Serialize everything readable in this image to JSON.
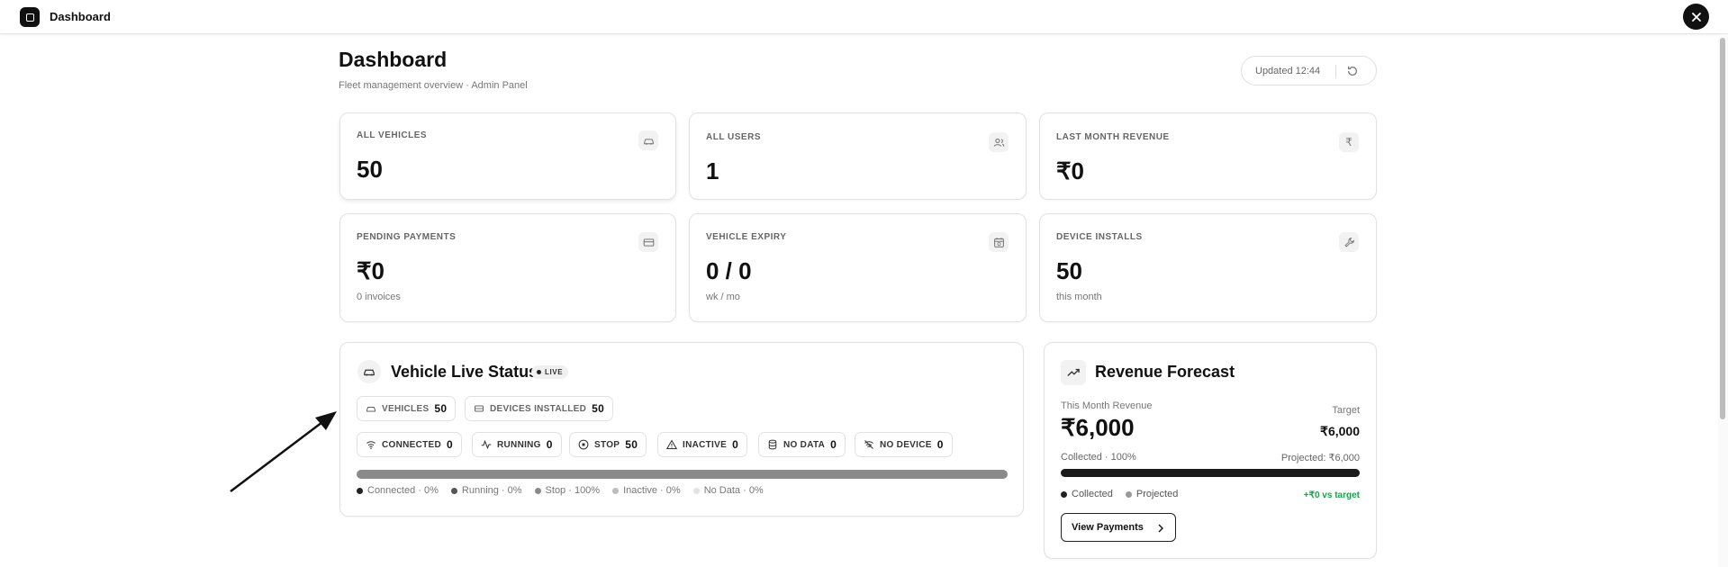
{
  "app": {
    "title": "Dashboard"
  },
  "header": {
    "title": "Dashboard",
    "subtitle": "Fleet management overview · Admin Panel",
    "updated": "Updated 12:44"
  },
  "stats": [
    {
      "label": "ALL VEHICLES",
      "value": "50",
      "sub": "",
      "icon": "car-icon"
    },
    {
      "label": "ALL USERS",
      "value": "1",
      "sub": "",
      "icon": "users-icon"
    },
    {
      "label": "LAST MONTH REVENUE",
      "value": "₹0",
      "sub": "",
      "icon": "rupee-icon"
    },
    {
      "label": "PENDING PAYMENTS",
      "value": "₹0",
      "sub": "0 invoices",
      "icon": "card-icon"
    },
    {
      "label": "VEHICLE EXPIRY",
      "value": "0 / 0",
      "sub": "wk / mo",
      "icon": "calendar-icon"
    },
    {
      "label": "DEVICE INSTALLS",
      "value": "50",
      "sub": "this month",
      "icon": "wrench-icon"
    }
  ],
  "live_status": {
    "title": "Vehicle Live Status",
    "badge": "LIVE",
    "summary": [
      {
        "label": "VEHICLES",
        "value": "50"
      },
      {
        "label": "DEVICES INSTALLED",
        "value": "50"
      }
    ],
    "statuses": [
      {
        "label": "CONNECTED",
        "value": "0"
      },
      {
        "label": "RUNNING",
        "value": "0"
      },
      {
        "label": "STOP",
        "value": "50"
      },
      {
        "label": "INACTIVE",
        "value": "0"
      },
      {
        "label": "NO DATA",
        "value": "0"
      },
      {
        "label": "NO DEVICE",
        "value": "0"
      }
    ],
    "progress_fraction": 1.0,
    "legend": [
      {
        "label": "Connected · 0%",
        "color": "#222222"
      },
      {
        "label": "Running · 0%",
        "color": "#555555"
      },
      {
        "label": "Stop · 100%",
        "color": "#8a8a8a"
      },
      {
        "label": "Inactive · 0%",
        "color": "#bdbdbd"
      },
      {
        "label": "No Data · 0%",
        "color": "#e3e3e3"
      }
    ]
  },
  "forecast": {
    "title": "Revenue Forecast",
    "this_month_label": "This Month Revenue",
    "this_month_value": "₹6,000",
    "target_label": "Target",
    "target_value": "₹6,000",
    "collected_text": "Collected · 100%",
    "projected_text": "Projected: ₹6,000",
    "collected_fraction": 1.0,
    "legend_collected": "Collected",
    "legend_projected": "Projected",
    "vs_target": "+₹0 vs target",
    "button": "View Payments",
    "accent": "#16a34a"
  }
}
